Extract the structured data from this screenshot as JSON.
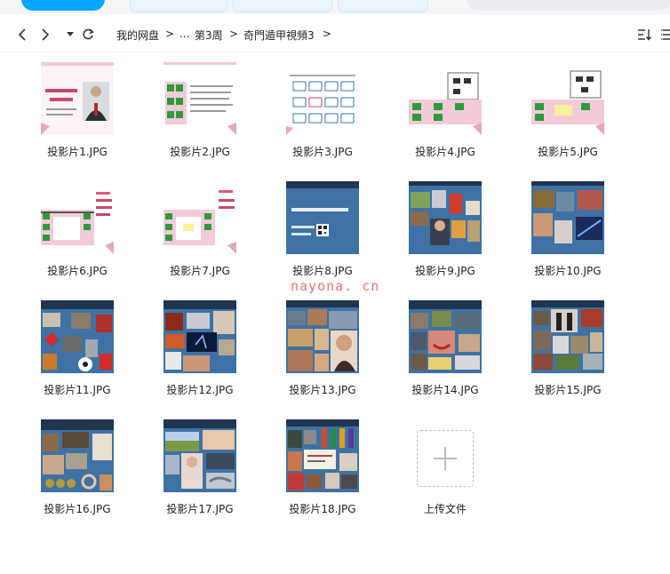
{
  "breadcrumb": {
    "root": "我的网盘",
    "ellipsis": "...",
    "week": "第3周",
    "current": "奇門遁甲視頻3",
    "separator": ">"
  },
  "files": [
    {
      "name": "投影片1.JPG"
    },
    {
      "name": "投影片2.JPG"
    },
    {
      "name": "投影片3.JPG"
    },
    {
      "name": "投影片4.JPG"
    },
    {
      "name": "投影片5.JPG"
    },
    {
      "name": "投影片6.JPG"
    },
    {
      "name": "投影片7.JPG"
    },
    {
      "name": "投影片8.JPG"
    },
    {
      "name": "投影片9.JPG"
    },
    {
      "name": "投影片10.JPG"
    },
    {
      "name": "投影片11.JPG"
    },
    {
      "name": "投影片12.JPG"
    },
    {
      "name": "投影片13.JPG"
    },
    {
      "name": "投影片14.JPG"
    },
    {
      "name": "投影片15.JPG"
    },
    {
      "name": "投影片16.JPG"
    },
    {
      "name": "投影片17.JPG"
    },
    {
      "name": "投影片18.JPG"
    }
  ],
  "upload": {
    "label": "上传文件"
  },
  "watermark": "nayona. cn",
  "colors": {
    "accent": "#06a7ff",
    "slide_blue": "#3e74a6",
    "slide_dark": "#1f3550",
    "pink": "#f6cfe0",
    "green": "#2e9a3a"
  }
}
